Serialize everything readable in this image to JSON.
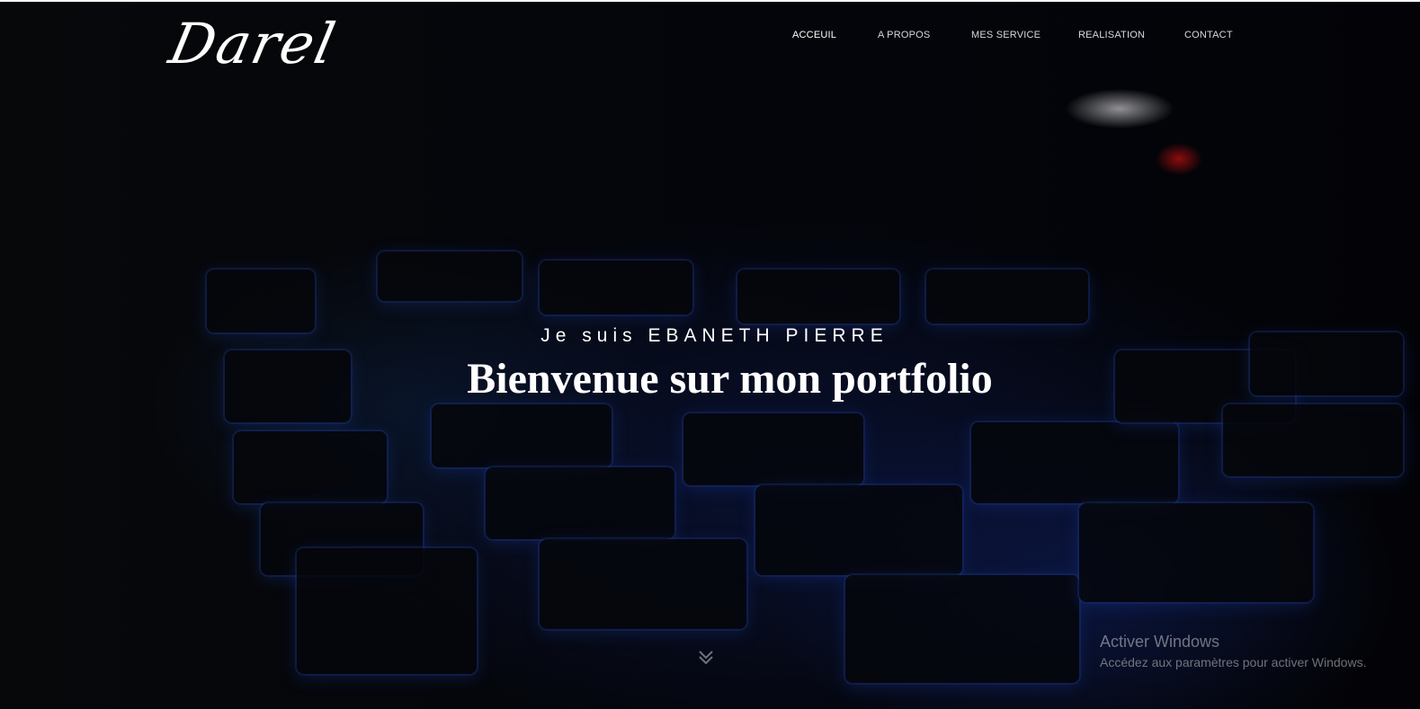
{
  "brand": {
    "logo_text": "Darel"
  },
  "nav": {
    "items": [
      {
        "label": "ACCEUIL",
        "active": true
      },
      {
        "label": "A PROPOS",
        "active": false
      },
      {
        "label": "MES SERVICE",
        "active": false
      },
      {
        "label": "REALISATION",
        "active": false
      },
      {
        "label": "CONTACT",
        "active": false
      }
    ]
  },
  "hero": {
    "subtitle": "Je suis EBANETH PIERRE",
    "title": "Bienvenue sur mon portfolio",
    "scroll_icon": "chevron-double-down-icon"
  },
  "windows_watermark": {
    "title": "Activer Windows",
    "subtitle": "Accédez aux paramètres pour activer Windows."
  },
  "colors": {
    "background": "#050608",
    "text": "#ffffff",
    "nav_text": "#d6d8de",
    "keyboard_glow": "#2850c8",
    "led_red": "#e61414"
  }
}
